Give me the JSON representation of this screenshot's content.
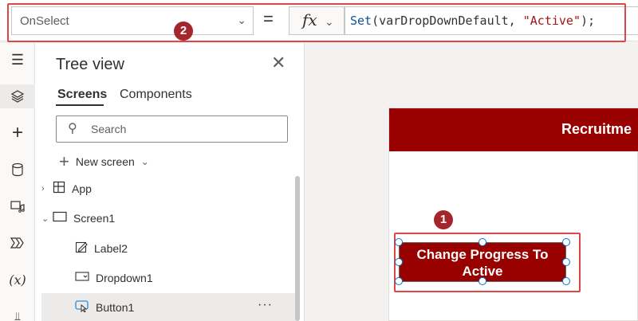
{
  "formula_bar": {
    "property": "OnSelect",
    "equals": "=",
    "fx_label": "fx",
    "formula": {
      "fn": "Set",
      "open": "(",
      "arg1": "varDropDownDefault, ",
      "arg2": "\"Active\"",
      "close": ");"
    }
  },
  "badges": {
    "one": "1",
    "two": "2"
  },
  "tree_view": {
    "title": "Tree view",
    "tabs": [
      "Screens",
      "Components"
    ],
    "search_placeholder": "Search",
    "new_screen": "New screen",
    "items": [
      {
        "label": "App",
        "icon": "app-icon",
        "expander": "›"
      },
      {
        "label": "Screen1",
        "icon": "screen-icon",
        "expander": "⌄"
      },
      {
        "label": "Label2",
        "icon": "label-edit-icon"
      },
      {
        "label": "Dropdown1",
        "icon": "dropdown-icon"
      },
      {
        "label": "Button1",
        "icon": "button-icon",
        "selected": true,
        "more": "···"
      }
    ]
  },
  "canvas": {
    "header_title": "Recruitme",
    "button_label": "Change Progress To Active"
  },
  "colors": {
    "accent": "#990000",
    "highlight": "#e04646",
    "badge": "#a4262c",
    "selection": "#0078d4"
  }
}
